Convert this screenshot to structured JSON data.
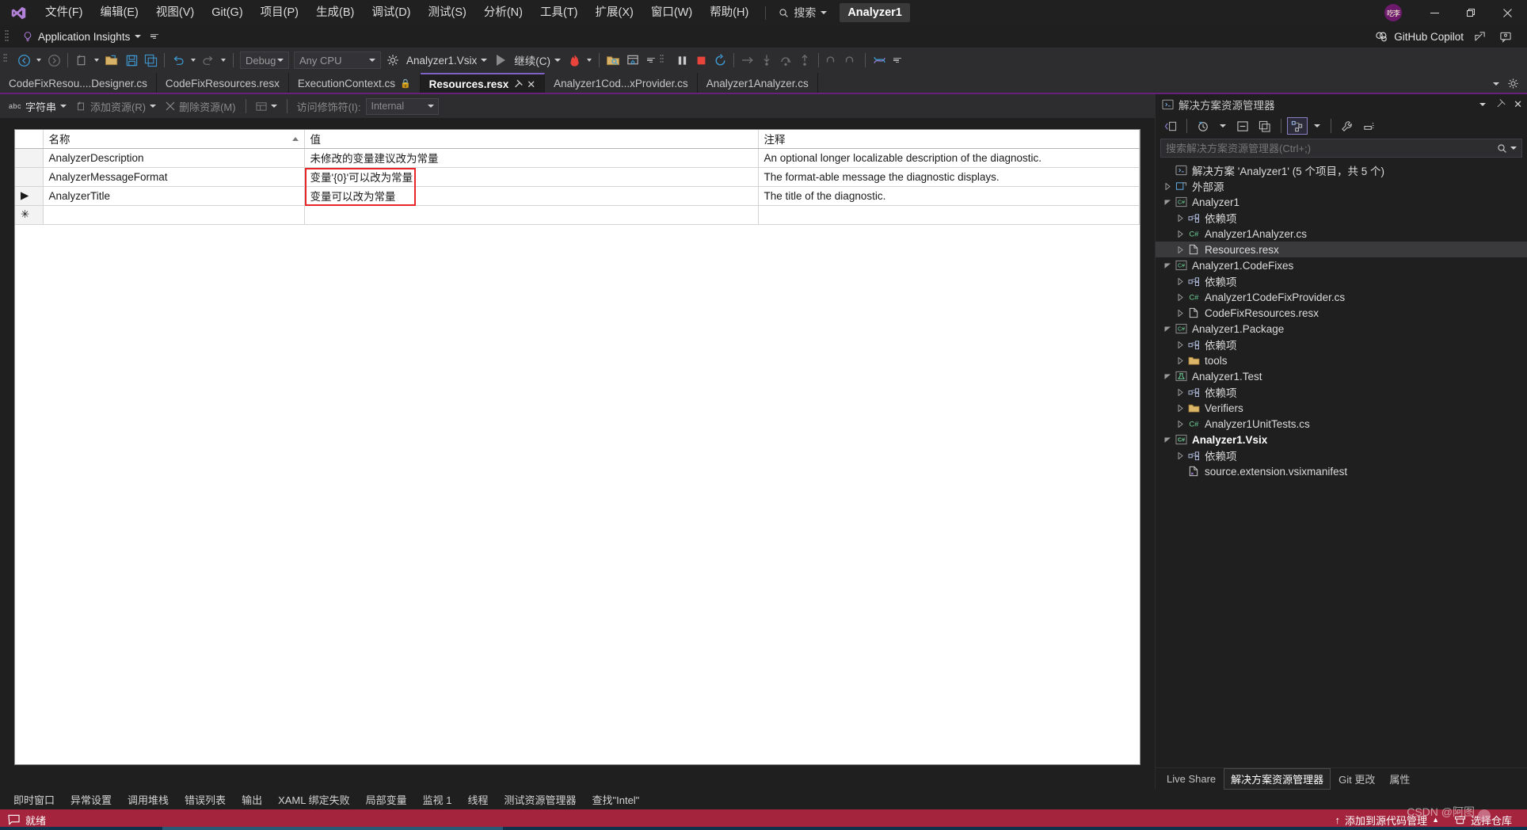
{
  "titlebar": {
    "logo_icon": "visual-studio-logo",
    "menus": [
      "文件(F)",
      "编辑(E)",
      "视图(V)",
      "Git(G)",
      "项目(P)",
      "生成(B)",
      "调试(D)",
      "测试(S)",
      "分析(N)",
      "工具(T)",
      "扩展(X)",
      "窗口(W)",
      "帮助(H)"
    ],
    "search_label": "搜索",
    "search_icon": "search-icon",
    "project_chip": "Analyzer1",
    "avatar_text": "吃李",
    "minimize": "—",
    "maximize": "❐",
    "close": "✕"
  },
  "row2": {
    "app_insights": "Application Insights",
    "bulb_icon": "lightbulb-icon",
    "copilot": "GitHub Copilot",
    "copilot_icon": "copilot-icon",
    "share_icon": "share-icon",
    "feedback_icon": "feedback-icon"
  },
  "toolbar": {
    "nav_back_icon": "navigate-back-icon",
    "nav_forward_icon": "navigate-forward-icon",
    "new_item_icon": "new-item-icon",
    "open_file_icon": "open-file-icon",
    "save_icon": "save-icon",
    "save_all_icon": "save-all-icon",
    "undo_icon": "undo-icon",
    "redo_icon": "redo-icon",
    "configuration": "Debug",
    "platform": "Any CPU",
    "startup_project": "Analyzer1.Vsix",
    "startup_icon": "gear-icon",
    "continue_label": "继续(C)",
    "hot_reload_icon": "hot-reload-icon",
    "live_visual_tree_icon": "live-visual-tree-icon",
    "live_property_icon": "live-property-explorer-icon",
    "pause_icon": "pause-icon",
    "stop_icon": "stop-icon",
    "restart_icon": "restart-icon",
    "show_next_statement_icon": "show-next-statement-icon",
    "step_into_icon": "step-into-icon",
    "step_over_icon": "step-over-icon",
    "step_out_icon": "step-out-icon",
    "step_back_icon": "step-backward-icon",
    "step_forward_icon": "step-forward-icon",
    "thread_icon": "threads-icon"
  },
  "tabs": [
    {
      "label": "CodeFixResou....Designer.cs",
      "active": false,
      "locked": false,
      "pinned": false
    },
    {
      "label": "CodeFixResources.resx",
      "active": false,
      "locked": false,
      "pinned": false
    },
    {
      "label": "ExecutionContext.cs",
      "active": false,
      "locked": true,
      "pinned": false
    },
    {
      "label": "Resources.resx",
      "active": true,
      "locked": false,
      "pinned": true
    },
    {
      "label": "Analyzer1Cod...xProvider.cs",
      "active": false,
      "locked": false,
      "pinned": false
    },
    {
      "label": "Analyzer1Analyzer.cs",
      "active": false,
      "locked": false,
      "pinned": false
    }
  ],
  "tabstrip_right": {
    "chevron_icon": "chevron-down-icon",
    "settings_icon": "gear-icon"
  },
  "resx_toolbar": {
    "abc_icon": "abc-icon",
    "view_type": "字符串",
    "add_resource": "添加资源(R)",
    "add_resource_icon": "add-resource-icon",
    "remove_resource": "删除资源(M)",
    "remove_resource_icon": "remove-resource-icon",
    "layout_icon": "grid-layout-icon",
    "access_modifier_label": "访问修饰符(I):",
    "access_modifier_value": "Internal"
  },
  "grid": {
    "columns": [
      "",
      "名称",
      "值",
      "注释"
    ],
    "sort_column": "名称",
    "sort_direction": "asc",
    "rows": [
      {
        "marker": "",
        "name": "AnalyzerDescription",
        "value": "未修改的变量建议改为常量",
        "comment": "An optional longer localizable description of the diagnostic."
      },
      {
        "marker": "",
        "name": "AnalyzerMessageFormat",
        "value": "变量'{0}'可以改为常量",
        "comment": "The format-able message the diagnostic displays."
      },
      {
        "marker": "▶",
        "name": "AnalyzerTitle",
        "value": "变量可以改为常量",
        "comment": "The title of the diagnostic."
      },
      {
        "marker": "✳",
        "name": "",
        "value": "",
        "comment": ""
      }
    ],
    "highlight_color": "#e8262a"
  },
  "solution_explorer": {
    "title": "解决方案资源管理器",
    "dropdown_icon": "chevron-down-icon",
    "pin_icon": "pin-icon",
    "close_icon": "close-icon",
    "toolbar_icons": [
      "code-view-icon",
      "pending-changes-icon",
      "collapse-all-icon",
      "new-window-icon",
      "properties-icon",
      "wrench-icon",
      "show-all-files-icon"
    ],
    "search_placeholder": "搜索解决方案资源管理器(Ctrl+;)",
    "search_icon": "search-icon",
    "tree": [
      {
        "depth": 0,
        "label": "解决方案 'Analyzer1' (5 个项目，共 5 个)",
        "icon": "solution-icon",
        "chevron": "",
        "bold": false,
        "selected": false
      },
      {
        "depth": 0,
        "label": "外部源",
        "icon": "external-sources-icon",
        "chevron": "collapsed",
        "bold": false,
        "selected": false
      },
      {
        "depth": 0,
        "label": "Analyzer1",
        "icon": "csharp-project-icon",
        "chevron": "expanded",
        "bold": false,
        "selected": false
      },
      {
        "depth": 1,
        "label": "依赖项",
        "icon": "dependencies-icon",
        "chevron": "collapsed",
        "bold": false,
        "selected": false
      },
      {
        "depth": 1,
        "label": "Analyzer1Analyzer.cs",
        "icon": "csharp-file-icon",
        "chevron": "collapsed",
        "bold": false,
        "selected": false
      },
      {
        "depth": 1,
        "label": "Resources.resx",
        "icon": "resx-file-icon",
        "chevron": "collapsed",
        "bold": false,
        "selected": true
      },
      {
        "depth": 0,
        "label": "Analyzer1.CodeFixes",
        "icon": "csharp-project-icon",
        "chevron": "expanded",
        "bold": false,
        "selected": false
      },
      {
        "depth": 1,
        "label": "依赖项",
        "icon": "dependencies-icon",
        "chevron": "collapsed",
        "bold": false,
        "selected": false
      },
      {
        "depth": 1,
        "label": "Analyzer1CodeFixProvider.cs",
        "icon": "csharp-file-icon",
        "chevron": "collapsed",
        "bold": false,
        "selected": false
      },
      {
        "depth": 1,
        "label": "CodeFixResources.resx",
        "icon": "resx-file-icon",
        "chevron": "collapsed",
        "bold": false,
        "selected": false
      },
      {
        "depth": 0,
        "label": "Analyzer1.Package",
        "icon": "csharp-project-icon",
        "chevron": "expanded",
        "bold": false,
        "selected": false
      },
      {
        "depth": 1,
        "label": "依赖项",
        "icon": "dependencies-icon",
        "chevron": "collapsed",
        "bold": false,
        "selected": false
      },
      {
        "depth": 1,
        "label": "tools",
        "icon": "folder-icon",
        "chevron": "collapsed",
        "bold": false,
        "selected": false
      },
      {
        "depth": 0,
        "label": "Analyzer1.Test",
        "icon": "test-project-icon",
        "chevron": "expanded",
        "bold": false,
        "selected": false
      },
      {
        "depth": 1,
        "label": "依赖项",
        "icon": "dependencies-icon",
        "chevron": "collapsed",
        "bold": false,
        "selected": false
      },
      {
        "depth": 1,
        "label": "Verifiers",
        "icon": "folder-icon",
        "chevron": "collapsed",
        "bold": false,
        "selected": false
      },
      {
        "depth": 1,
        "label": "Analyzer1UnitTests.cs",
        "icon": "csharp-file-icon",
        "chevron": "collapsed",
        "bold": false,
        "selected": false
      },
      {
        "depth": 0,
        "label": "Analyzer1.Vsix",
        "icon": "csharp-project-icon",
        "chevron": "expanded",
        "bold": true,
        "selected": false
      },
      {
        "depth": 1,
        "label": "依赖项",
        "icon": "dependencies-icon",
        "chevron": "collapsed",
        "bold": false,
        "selected": false
      },
      {
        "depth": 1,
        "label": "source.extension.vsixmanifest",
        "icon": "vsix-manifest-icon",
        "chevron": "",
        "bold": false,
        "selected": false
      }
    ],
    "tabs": [
      {
        "label": "Live Share",
        "active": false
      },
      {
        "label": "解决方案资源管理器",
        "active": true
      },
      {
        "label": "Git 更改",
        "active": false
      },
      {
        "label": "属性",
        "active": false
      }
    ]
  },
  "bottom_tabs": [
    "即时窗口",
    "异常设置",
    "调用堆栈",
    "错误列表",
    "输出",
    "XAML 绑定失败",
    "局部变量",
    "监视 1",
    "线程",
    "测试资源管理器",
    "查找\"Intel\""
  ],
  "status_bar": {
    "ready_icon": "ready-icon",
    "ready_text": "就绪",
    "add_source_control_icon": "arrow-up-icon",
    "add_source_control": "添加到源代码管理",
    "source_control_caret": "▲",
    "select_repo_icon": "repository-icon",
    "select_repo": "选择仓库",
    "watermark": "CSDN @阿图",
    "background_color": "#a4243d"
  }
}
